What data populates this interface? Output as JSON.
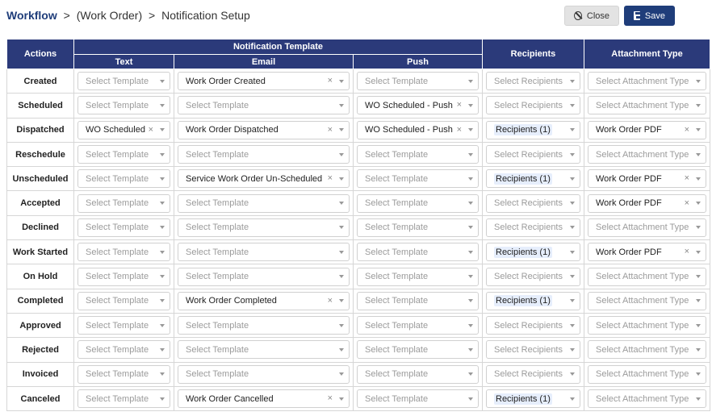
{
  "breadcrumb": {
    "root": "Workflow",
    "middle": "(Work Order)",
    "current": "Notification Setup",
    "separator": ">"
  },
  "toolbar": {
    "close_label": "Close",
    "save_label": "Save"
  },
  "headers": {
    "actions": "Actions",
    "notification_template": "Notification Template",
    "text": "Text",
    "email": "Email",
    "push": "Push",
    "recipients": "Recipients",
    "attachment_type": "Attachment Type"
  },
  "placeholders": {
    "template": "Select Template",
    "recipients": "Select Recipients",
    "attachment": "Select Attachment Type"
  },
  "rows": [
    {
      "action": "Created",
      "text": "",
      "email": "Work Order Created",
      "push": "",
      "recipients": "",
      "attachment": ""
    },
    {
      "action": "Scheduled",
      "text": "",
      "email": "",
      "push": "WO Scheduled - Push",
      "recipients": "",
      "attachment": ""
    },
    {
      "action": "Dispatched",
      "text": "WO Scheduled",
      "email": "Work Order Dispatched",
      "push": "WO Scheduled - Push",
      "recipients": "Recipients (1)",
      "attachment": "Work Order PDF"
    },
    {
      "action": "Reschedule",
      "text": "",
      "email": "",
      "push": "",
      "recipients": "",
      "attachment": ""
    },
    {
      "action": "Unscheduled",
      "text": "",
      "email": "Service Work Order Un-Scheduled",
      "push": "",
      "recipients": "Recipients (1)",
      "attachment": "Work Order PDF"
    },
    {
      "action": "Accepted",
      "text": "",
      "email": "",
      "push": "",
      "recipients": "",
      "attachment": "Work Order PDF"
    },
    {
      "action": "Declined",
      "text": "",
      "email": "",
      "push": "",
      "recipients": "",
      "attachment": ""
    },
    {
      "action": "Work Started",
      "text": "",
      "email": "",
      "push": "",
      "recipients": "Recipients (1)",
      "attachment": "Work Order PDF"
    },
    {
      "action": "On Hold",
      "text": "",
      "email": "",
      "push": "",
      "recipients": "",
      "attachment": ""
    },
    {
      "action": "Completed",
      "text": "",
      "email": "Work Order Completed",
      "push": "",
      "recipients": "Recipients (1)",
      "attachment": ""
    },
    {
      "action": "Approved",
      "text": "",
      "email": "",
      "push": "",
      "recipients": "",
      "attachment": ""
    },
    {
      "action": "Rejected",
      "text": "",
      "email": "",
      "push": "",
      "recipients": "",
      "attachment": ""
    },
    {
      "action": "Invoiced",
      "text": "",
      "email": "",
      "push": "",
      "recipients": "",
      "attachment": ""
    },
    {
      "action": "Canceled",
      "text": "",
      "email": "Work Order Cancelled",
      "push": "",
      "recipients": "Recipients (1)",
      "attachment": ""
    }
  ],
  "icons": {
    "close": "close-circle-icon",
    "save": "floppy-disk-icon",
    "clear": "clear-x-icon",
    "dropdown": "chevron-down-icon"
  }
}
